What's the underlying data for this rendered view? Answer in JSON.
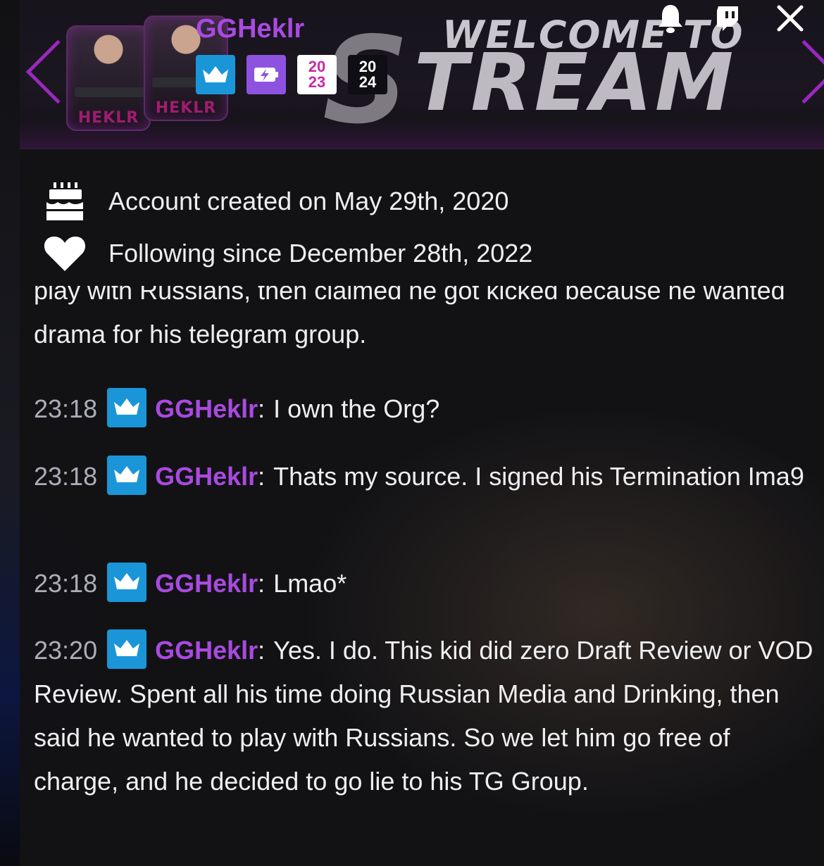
{
  "banner": {
    "username": "GGHeklr",
    "welcome_text": "WELCOME TO",
    "stream_text": "TREAM",
    "stream_initial": "S",
    "avatar_tag": "HEKLR",
    "badges": [
      {
        "name": "crown-badge-icon"
      },
      {
        "name": "prime-badge-icon"
      },
      {
        "name": "year-2023-badge",
        "line1": "20",
        "line2": "23"
      },
      {
        "name": "year-2024-badge",
        "line1": "20",
        "line2": "24"
      }
    ]
  },
  "header_icons": {
    "bell": "bell-icon",
    "twitch": "twitch-icon",
    "close": "close-icon"
  },
  "profile": {
    "account_created": "Account created on May 29th, 2020",
    "following_since": "Following since December 28th, 2022"
  },
  "chat": {
    "partial_message": "play with Russians, then claimed he got kicked because he wanted drama for his telegram group.",
    "messages": [
      {
        "time": "23:18",
        "user": "GGHeklr",
        "text": "I own the Org?"
      },
      {
        "time": "23:18",
        "user": "GGHeklr",
        "text": "Thats my source. I signed his Termination Ima9"
      },
      {
        "time": "23:18",
        "user": "GGHeklr",
        "text": "Lmao*"
      },
      {
        "time": "23:20",
        "user": "GGHeklr",
        "text": "Yes. I do. This kid did zero Draft Review or VOD Review. Spent all his time doing Russian Media and Drinking, then said he wanted to play with Russians. So we let him go free of charge, and he decided to go lie to his TG Group."
      }
    ]
  },
  "colors": {
    "username": "#a94ae0",
    "crown_badge": "#1a96d8",
    "prime_badge": "#8e52e0",
    "timestamp": "#adadb8",
    "text": "#efeff1"
  }
}
